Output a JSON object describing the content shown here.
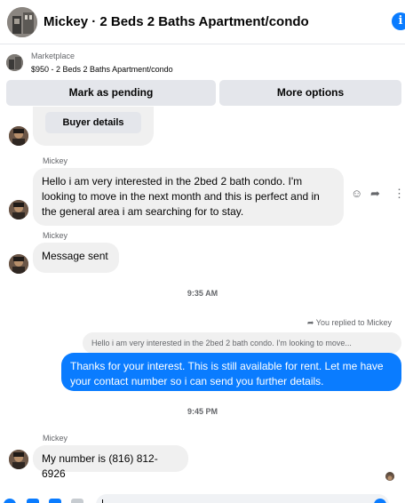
{
  "header": {
    "title": "Mickey · 2 Beds 2 Baths Apartment/condo",
    "info_icon": "info-icon",
    "accent": "#0a7cff"
  },
  "marketplace": {
    "label": "Marketplace",
    "listing": "$950 - 2 Beds 2 Baths Apartment/condo",
    "mark_pending": "Mark as pending",
    "more_options": "More options"
  },
  "messages": {
    "buyer_details": "Buyer details",
    "sender_name": "Mickey",
    "m1": "Hello i am very interested in the 2bed 2 bath condo. I'm looking to move in the next month and this is perfect and in the general area i am searching for to stay.",
    "m2": "Message sent",
    "time1": "9:35 AM",
    "replied_label": "You replied to Mickey",
    "quoted": "Hello i am very interested in the 2bed 2 bath condo. I'm looking to move...",
    "reply": "Thanks for your interest. This is still available for rent. Let me have your contact number so i can send you further details.",
    "time2": "9:45 PM",
    "m3": "My number is (816) 812-6926"
  },
  "icons": {
    "react": "smile-icon",
    "reply": "reply-icon",
    "more": "more-vertical-icon"
  }
}
